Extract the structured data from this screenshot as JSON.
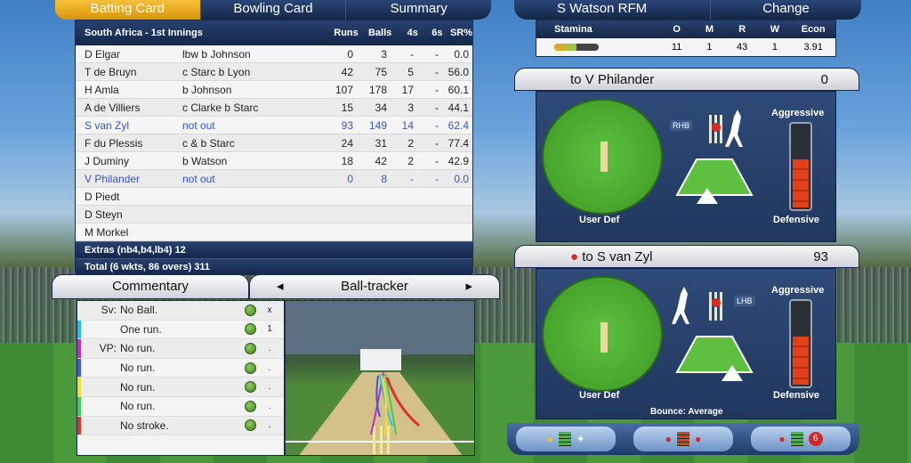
{
  "tabs": [
    {
      "label": "Batting Card"
    },
    {
      "label": "Bowling Card"
    },
    {
      "label": "Summary"
    }
  ],
  "batting": {
    "innings_title": "South Africa - 1st Innings",
    "columns": [
      "Runs",
      "Balls",
      "4s",
      "6s",
      "SR%"
    ],
    "rows": [
      {
        "name": "D Elgar",
        "how": "lbw b Johnson",
        "runs": "0",
        "balls": "3",
        "fours": "-",
        "sixes": "-",
        "sr": "0.0",
        "notout": false
      },
      {
        "name": "T de Bruyn",
        "how": "c Starc b Lyon",
        "runs": "42",
        "balls": "75",
        "fours": "5",
        "sixes": "-",
        "sr": "56.0",
        "notout": false
      },
      {
        "name": "H Amla",
        "how": "b Johnson",
        "runs": "107",
        "balls": "178",
        "fours": "17",
        "sixes": "-",
        "sr": "60.1",
        "notout": false
      },
      {
        "name": "A de Villiers",
        "how": "c Clarke b Starc",
        "runs": "15",
        "balls": "34",
        "fours": "3",
        "sixes": "-",
        "sr": "44.1",
        "notout": false
      },
      {
        "name": "S van Zyl",
        "how": "not out",
        "runs": "93",
        "balls": "149",
        "fours": "14",
        "sixes": "-",
        "sr": "62.4",
        "notout": true
      },
      {
        "name": "F du Plessis",
        "how": "c & b Starc",
        "runs": "24",
        "balls": "31",
        "fours": "2",
        "sixes": "-",
        "sr": "77.4",
        "notout": false
      },
      {
        "name": "J Duminy",
        "how": "b Watson",
        "runs": "18",
        "balls": "42",
        "fours": "2",
        "sixes": "-",
        "sr": "42.9",
        "notout": false
      },
      {
        "name": "V Philander",
        "how": "not out",
        "runs": "0",
        "balls": "8",
        "fours": "-",
        "sixes": "-",
        "sr": "0.0",
        "notout": true
      },
      {
        "name": "D Piedt",
        "how": "",
        "runs": "",
        "balls": "",
        "fours": "",
        "sixes": "",
        "sr": "",
        "notout": false
      },
      {
        "name": "D Steyn",
        "how": "",
        "runs": "",
        "balls": "",
        "fours": "",
        "sixes": "",
        "sr": "",
        "notout": false
      },
      {
        "name": "M Morkel",
        "how": "",
        "runs": "",
        "balls": "",
        "fours": "",
        "sixes": "",
        "sr": "",
        "notout": false
      }
    ],
    "extras": "Extras (nb4,b4,lb4) 12",
    "total": "Total (6 wkts, 86 overs) 311"
  },
  "commentary_tabs": {
    "commentary": "Commentary",
    "tracker": "Ball-tracker",
    "prev": "◂",
    "next": "▸"
  },
  "commentary": [
    {
      "who": "Sv:",
      "text": "No Ball.",
      "result": "x",
      "bar": ""
    },
    {
      "who": "",
      "text": "One run.",
      "result": "1",
      "bar": "#22c4e0"
    },
    {
      "who": "VP:",
      "text": "No run.",
      "result": ".",
      "bar": "#c22bd1"
    },
    {
      "who": "",
      "text": "No run.",
      "result": ".",
      "bar": "#3f55e0"
    },
    {
      "who": "",
      "text": "No run.",
      "result": ".",
      "bar": "#f0e32a"
    },
    {
      "who": "",
      "text": "No run.",
      "result": ".",
      "bar": "#39d24f"
    },
    {
      "who": "",
      "text": "No stroke.",
      "result": ".",
      "bar": "#e0302a"
    }
  ],
  "bowler": {
    "name": "S Watson RFM",
    "change_label": "Change",
    "stat_headers": [
      "Stamina",
      "O",
      "M",
      "R",
      "W",
      "Econ"
    ],
    "stats": {
      "overs": "11",
      "maidens": "1",
      "runs": "43",
      "wickets": "1",
      "econ": "3.91"
    },
    "stamina_fraction": 0.5
  },
  "batsman_top": {
    "title": "to V Philander",
    "score": "0",
    "hand": "RHB",
    "aggressive": "Aggressive",
    "defensive": "Defensive",
    "field": "User Def",
    "aggression_fraction": 0.6
  },
  "batsman_bottom": {
    "title": "to S van Zyl",
    "score": "93",
    "hand": "LHB",
    "aggressive": "Aggressive",
    "defensive": "Defensive",
    "field": "User Def",
    "bounce": "Bounce: Average",
    "aggression_fraction": 0.6
  },
  "bottom_buttons": [
    {
      "icon": "sun-icon"
    },
    {
      "icon": "ball-icon"
    },
    {
      "icon": "six-icon",
      "badge": "6"
    }
  ]
}
